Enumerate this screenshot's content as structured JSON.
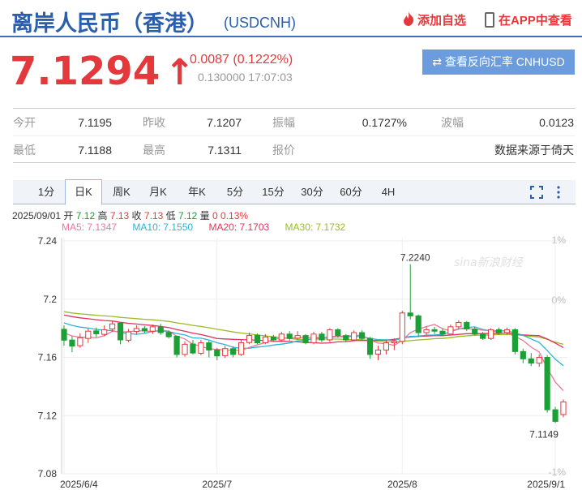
{
  "header": {
    "title": "离岸人民币（香港）",
    "code": "(USDCNH)",
    "add_watch": "添加自选",
    "app_view": "在APP中查看"
  },
  "quote": {
    "price": "7.1294",
    "arrow": "↑",
    "change": "0.0087 (0.1222%)",
    "sub": "0.130000 17:07:03",
    "reverse_btn": "⇄ 查看反向汇率 CNHUSD"
  },
  "stats": {
    "row1": [
      {
        "label": "今开",
        "value": "7.1195"
      },
      {
        "label": "昨收",
        "value": "7.1207"
      },
      {
        "label": "振幅",
        "value": "0.1727%"
      },
      {
        "label": "波幅",
        "value": "0.0123"
      }
    ],
    "row2": [
      {
        "label": "最低",
        "value": "7.1188"
      },
      {
        "label": "最高",
        "value": "7.1311"
      },
      {
        "label": "报价",
        "value": ""
      },
      {
        "label": "",
        "value": "数据来源于倚天"
      }
    ]
  },
  "toolbar": {
    "tabs": [
      "1分",
      "日K",
      "周K",
      "月K",
      "年K",
      "5分",
      "15分",
      "30分",
      "60分",
      "4H"
    ],
    "active": 1
  },
  "info": {
    "date": "2025/09/01",
    "open_l": "开",
    "open": "7.12",
    "high_l": "高",
    "high": "7.13",
    "close_l": "收",
    "close": "7.13",
    "low_l": "低",
    "low": "7.12",
    "vol_l": "量",
    "vol": "0",
    "pct": "0.13%"
  },
  "ma": {
    "ma5": "MA5: 7.1347",
    "ma10": "MA10: 7.1550",
    "ma20": "MA20: 7.1703",
    "ma30": "MA30: 7.1732",
    "colors": {
      "ma5": "#e9789c",
      "ma10": "#2cb3d6",
      "ma20": "#e2325e",
      "ma30": "#9bbb23"
    }
  },
  "colors": {
    "up": "#e4393c",
    "down": "#1aa034",
    "accent": "#2b5fae"
  },
  "watermark": "sina新浪财经",
  "chart_data": {
    "type": "candlestick",
    "yticks": [
      "7.24",
      "7.2",
      "7.16",
      "7.12",
      "7.08"
    ],
    "yvals": [
      7.24,
      7.2,
      7.16,
      7.12,
      7.08
    ],
    "ylim": [
      7.08,
      7.24
    ],
    "pct_ticks": [
      "1%",
      "0%",
      "-1%"
    ],
    "xticks": [
      "2025/6/4",
      "2025/7",
      "2025/8",
      "2025/9/1"
    ],
    "xtick_idx": [
      0,
      19,
      42,
      61
    ],
    "max_label": "7.2240",
    "min_label": "7.1149",
    "candles": [
      [
        7.1793,
        7.1718,
        7.182,
        7.168
      ],
      [
        7.1719,
        7.1677,
        7.1745,
        7.1635
      ],
      [
        7.168,
        7.1735,
        7.1765,
        7.1665
      ],
      [
        7.173,
        7.178,
        7.18,
        7.17
      ],
      [
        7.1782,
        7.1762,
        7.1805,
        7.174
      ],
      [
        7.1758,
        7.179,
        7.182,
        7.1745
      ],
      [
        7.1795,
        7.183,
        7.185,
        7.1775
      ],
      [
        7.1835,
        7.172,
        7.184,
        7.169
      ],
      [
        7.1718,
        7.1775,
        7.1795,
        7.1705
      ],
      [
        7.1778,
        7.1798,
        7.182,
        7.176
      ],
      [
        7.1798,
        7.1783,
        7.1815,
        7.1765
      ],
      [
        7.178,
        7.181,
        7.1825,
        7.176
      ],
      [
        7.1808,
        7.177,
        7.183,
        7.1755
      ],
      [
        7.1772,
        7.1742,
        7.1785,
        7.173
      ],
      [
        7.1745,
        7.162,
        7.175,
        7.16
      ],
      [
        7.162,
        7.169,
        7.171,
        7.1605
      ],
      [
        7.1692,
        7.163,
        7.172,
        7.162
      ],
      [
        7.1628,
        7.17,
        7.172,
        7.1615
      ],
      [
        7.17,
        7.165,
        7.1715,
        7.16
      ],
      [
        7.165,
        7.161,
        7.1665,
        7.158
      ],
      [
        7.1612,
        7.166,
        7.168,
        7.1595
      ],
      [
        7.166,
        7.162,
        7.1675,
        7.16
      ],
      [
        7.162,
        7.17,
        7.172,
        7.161
      ],
      [
        7.1702,
        7.175,
        7.177,
        7.169
      ],
      [
        7.1752,
        7.17,
        7.1765,
        7.169
      ],
      [
        7.17,
        7.174,
        7.176,
        7.169
      ],
      [
        7.174,
        7.172,
        7.1755,
        7.171
      ],
      [
        7.172,
        7.176,
        7.1775,
        7.1705
      ],
      [
        7.176,
        7.173,
        7.178,
        7.1715
      ],
      [
        7.1732,
        7.175,
        7.178,
        7.172
      ],
      [
        7.175,
        7.17,
        7.176,
        7.169
      ],
      [
        7.17,
        7.176,
        7.1775,
        7.169
      ],
      [
        7.176,
        7.172,
        7.1775,
        7.1705
      ],
      [
        7.172,
        7.179,
        7.18,
        7.1705
      ],
      [
        7.179,
        7.175,
        7.18,
        7.1735
      ],
      [
        7.175,
        7.172,
        7.176,
        7.1705
      ],
      [
        7.172,
        7.177,
        7.1785,
        7.171
      ],
      [
        7.177,
        7.173,
        7.1785,
        7.1715
      ],
      [
        7.173,
        7.162,
        7.174,
        7.159
      ],
      [
        7.1622,
        7.165,
        7.168,
        7.158
      ],
      [
        7.165,
        7.17,
        7.172,
        7.162
      ],
      [
        7.17,
        7.171,
        7.173,
        7.165
      ],
      [
        7.171,
        7.1905,
        7.192,
        7.169
      ],
      [
        7.1905,
        7.1885,
        7.224,
        7.186
      ],
      [
        7.1885,
        7.177,
        7.1895,
        7.174
      ],
      [
        7.177,
        7.179,
        7.181,
        7.1755
      ],
      [
        7.179,
        7.178,
        7.181,
        7.176
      ],
      [
        7.178,
        7.176,
        7.18,
        7.1745
      ],
      [
        7.176,
        7.181,
        7.1825,
        7.175
      ],
      [
        7.181,
        7.184,
        7.1855,
        7.179
      ],
      [
        7.184,
        7.1795,
        7.185,
        7.178
      ],
      [
        7.1795,
        7.176,
        7.181,
        7.175
      ],
      [
        7.176,
        7.173,
        7.1775,
        7.172
      ],
      [
        7.173,
        7.179,
        7.18,
        7.172
      ],
      [
        7.179,
        7.177,
        7.1805,
        7.1755
      ],
      [
        7.177,
        7.179,
        7.1805,
        7.1755
      ],
      [
        7.179,
        7.164,
        7.18,
        7.162
      ],
      [
        7.164,
        7.159,
        7.166,
        7.156
      ],
      [
        7.159,
        7.156,
        7.163,
        7.154
      ],
      [
        7.156,
        7.16,
        7.162,
        7.1535
      ],
      [
        7.16,
        7.124,
        7.1615,
        7.122
      ],
      [
        7.124,
        7.116,
        7.126,
        7.1149
      ],
      [
        7.1207,
        7.1294,
        7.1311,
        7.1188
      ]
    ]
  }
}
